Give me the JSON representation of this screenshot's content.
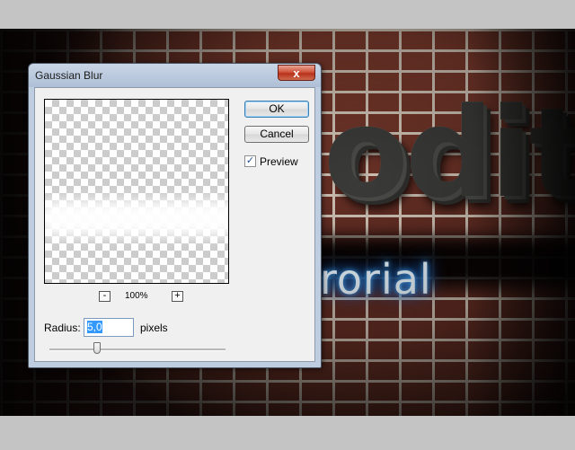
{
  "artwork": {
    "metal_text": "odit",
    "glow_text": "rorial"
  },
  "dialog": {
    "title": "Gaussian Blur",
    "close_label": "x",
    "ok_label": "OK",
    "cancel_label": "Cancel",
    "preview": {
      "checkbox_mark": "✓",
      "checked": true,
      "label": "Preview"
    },
    "zoom": {
      "out_label": "-",
      "level": "100%",
      "in_label": "+"
    },
    "radius": {
      "label": "Radius:",
      "value": "5,0",
      "unit": "pixels",
      "slider_fraction": 0.27
    }
  },
  "colors": {
    "glow_accent": "#2c8fff",
    "close_button": "#c8402a",
    "selection": "#3399ff"
  }
}
